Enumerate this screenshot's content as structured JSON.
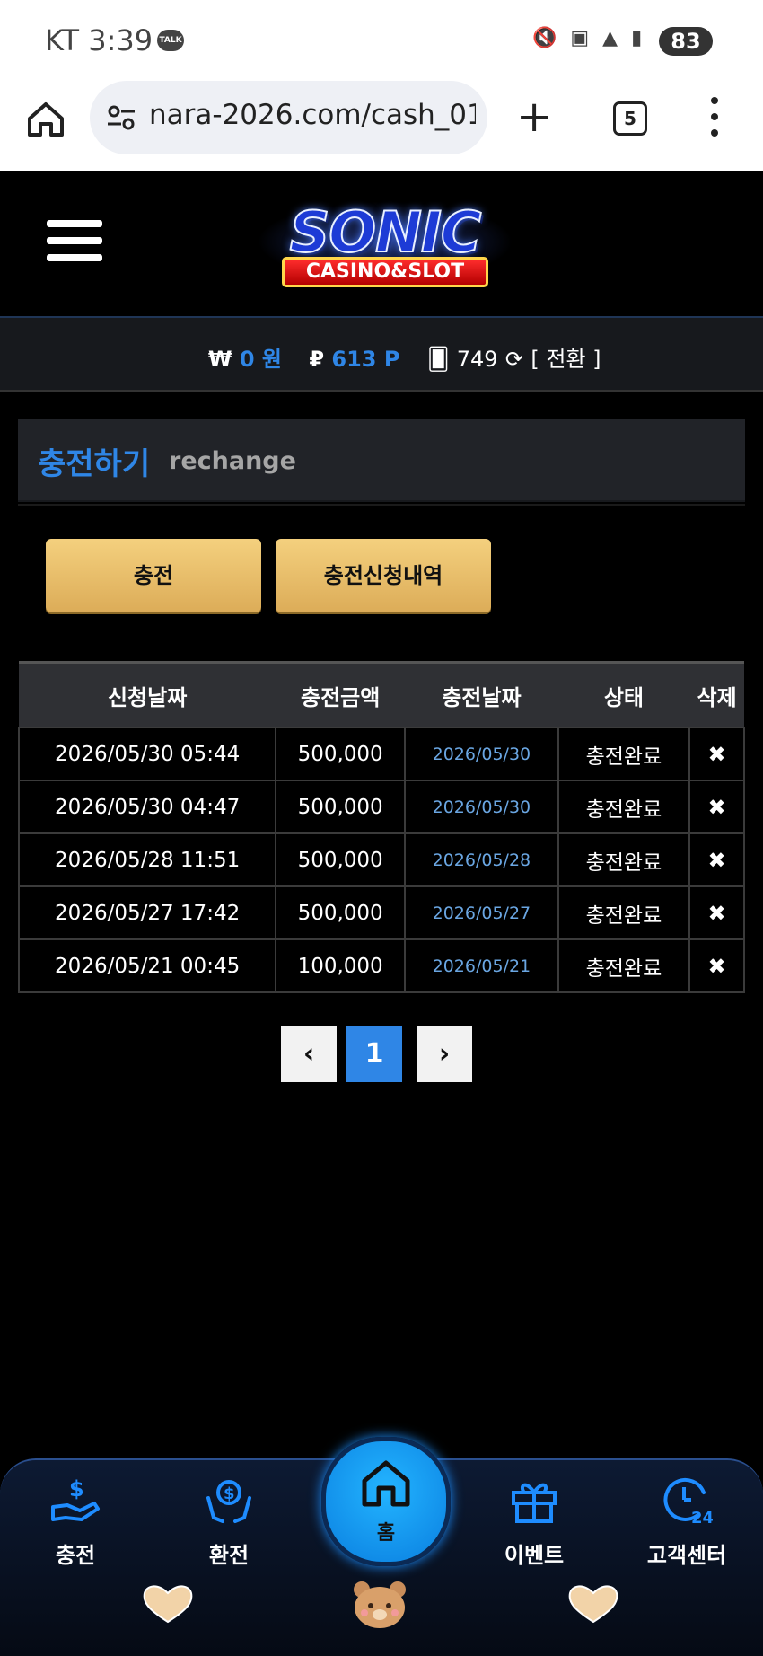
{
  "status_bar": {
    "carrier_time": "KT 3:39",
    "talk": "TALK",
    "battery": "83"
  },
  "browser": {
    "url": "nara-2026.com/cash_01",
    "tab_count": "5"
  },
  "header": {
    "logo_main": "SONIC",
    "logo_sub": "CASINO&SLOT"
  },
  "balance": {
    "won_symbol": "₩",
    "won_value": "0 원",
    "point_symbol": "₽",
    "point_value": "613 P",
    "chip_value": "749",
    "convert_label": "[ 전환 ]"
  },
  "section": {
    "title_ko": "충전하기",
    "title_en": "rechange"
  },
  "actions": {
    "charge_label": "충전",
    "history_label": "충전신청내역"
  },
  "table": {
    "headers": [
      "신청날짜",
      "충전금액",
      "충전날짜",
      "상태",
      "삭제"
    ],
    "rows": [
      {
        "requested": "2026/05/30 05:44",
        "amount": "500,000",
        "charged": "2026/05/30",
        "status": "충전완료",
        "delete": "✖"
      },
      {
        "requested": "2026/05/30 04:47",
        "amount": "500,000",
        "charged": "2026/05/30",
        "status": "충전완료",
        "delete": "✖"
      },
      {
        "requested": "2026/05/28 11:51",
        "amount": "500,000",
        "charged": "2026/05/28",
        "status": "충전완료",
        "delete": "✖"
      },
      {
        "requested": "2026/05/27 17:42",
        "amount": "500,000",
        "charged": "2026/05/27",
        "status": "충전완료",
        "delete": "✖"
      },
      {
        "requested": "2026/05/21 00:45",
        "amount": "100,000",
        "charged": "2026/05/21",
        "status": "충전완료",
        "delete": "✖"
      }
    ]
  },
  "pagination": {
    "prev": "‹",
    "current": "1",
    "next": "›"
  },
  "bottom_nav": {
    "charge": "충전",
    "exchange": "환전",
    "home": "홈",
    "event": "이벤트",
    "support": "고객센터"
  },
  "colors": {
    "accent": "#2f86e6",
    "button_gold": "#e8be6a",
    "background": "#000000"
  }
}
